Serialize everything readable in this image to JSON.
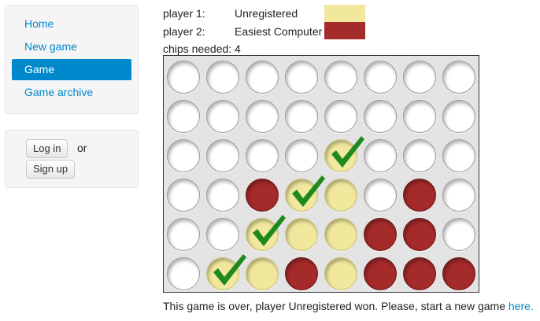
{
  "nav": {
    "items": [
      {
        "label": "Home",
        "active": false
      },
      {
        "label": "New game",
        "active": false
      },
      {
        "label": "Game",
        "active": true
      },
      {
        "label": "Game archive",
        "active": false
      }
    ]
  },
  "auth": {
    "login_label": "Log in",
    "or_label": "or",
    "signup_label": "Sign up"
  },
  "game": {
    "player1_label": "player 1:",
    "player1_name": "Unregistered",
    "player1_color": "#f1e89e",
    "player2_label": "player 2:",
    "player2_name": "Easiest Computer",
    "player2_color": "#a52a2a",
    "chips_label": "chips needed:",
    "chips_value": "4",
    "empty_color": "#ffffff",
    "check_color": "#1e8a1e",
    "board": [
      [
        0,
        0,
        0,
        0,
        0,
        0,
        0,
        0
      ],
      [
        0,
        0,
        0,
        0,
        0,
        0,
        0,
        0
      ],
      [
        0,
        0,
        0,
        0,
        1,
        0,
        0,
        0
      ],
      [
        0,
        0,
        2,
        1,
        1,
        0,
        2,
        0
      ],
      [
        0,
        0,
        1,
        1,
        1,
        2,
        2,
        0
      ],
      [
        0,
        1,
        1,
        2,
        1,
        2,
        2,
        2
      ]
    ],
    "winning_cells": [
      [
        2,
        4
      ],
      [
        3,
        3
      ],
      [
        4,
        2
      ],
      [
        5,
        1
      ]
    ]
  },
  "status": {
    "message": "This game is over, player Unregistered won. Please, start a new game ",
    "link_label": "here."
  }
}
